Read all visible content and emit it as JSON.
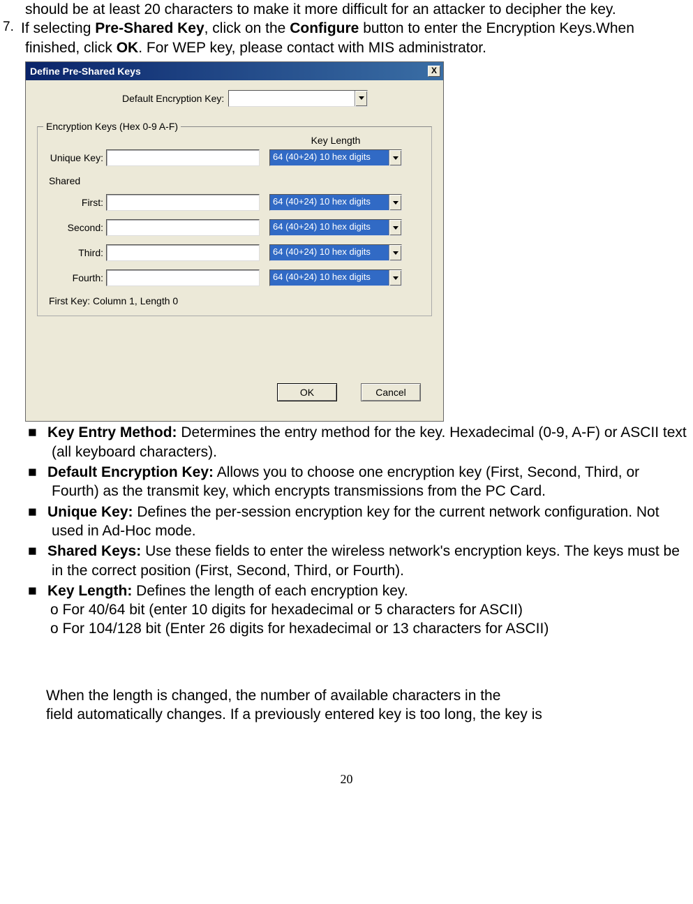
{
  "doc": {
    "line1": "should be at least 20 characters to make it more difficult for an attacker to decipher the key.",
    "ol7_marker": "7.",
    "ol7_a": "If selecting ",
    "ol7_b": "Pre-Shared Key",
    "ol7_c": ", click on the ",
    "ol7_d": "Configure",
    "ol7_e": " button to enter the Encryption Keys.When finished, click ",
    "ol7_f": "OK",
    "ol7_g": ". For WEP key, please contact with MIS administrator."
  },
  "dialog": {
    "title": "Define Pre-Shared Keys",
    "close": "X",
    "default_label": "Default Encryption Key:",
    "default_value": "",
    "group_legend": "Encryption Keys (Hex 0-9 A-F)",
    "keylen_header": "Key Length",
    "unique_label": "Unique Key:",
    "shared_label": "Shared",
    "first_label": "First:",
    "second_label": "Second:",
    "third_label": "Third:",
    "fourth_label": "Fourth:",
    "keylen_option": "64  (40+24)  10 hex digits",
    "status": "First Key: Column 1,  Length 0",
    "ok": "OK",
    "cancel": "Cancel"
  },
  "bullets": {
    "b1_bold": "Key Entry Method:",
    "b1_rest": " Determines the entry method for the key. Hexadecimal (0-9, A-F) or ASCII text (all keyboard characters).",
    "b2_bold": "Default Encryption Key:",
    "b2_rest": " Allows you to choose one encryption key (First, Second, Third, or Fourth) as the transmit key, which encrypts transmissions from the PC Card.",
    "b3_bold": "Unique Key:",
    "b3_rest": " Defines the per-session encryption key for the current network configuration. Not used in Ad-Hoc mode.",
    "b4_bold": "Shared Keys:",
    "b4_rest": " Use these fields to enter the wireless network's encryption keys. The keys must be in the correct position (First, Second, Third, or Fourth).",
    "b5_bold": "Key Length:",
    "b5_rest": " Defines the length of each encryption key.",
    "b5_sub1": "o For 40/64 bit (enter 10 digits for hexadecimal or 5 characters for ASCII)",
    "b5_sub2": "o For 104/128 bit (Enter 26 digits for hexadecimal or 13 characters for ASCII)"
  },
  "bottom": {
    "line1": "When the length is changed, the number of available characters in the",
    "line2": "field automatically changes. If a previously entered key is too long, the key is"
  },
  "page_number": "20"
}
